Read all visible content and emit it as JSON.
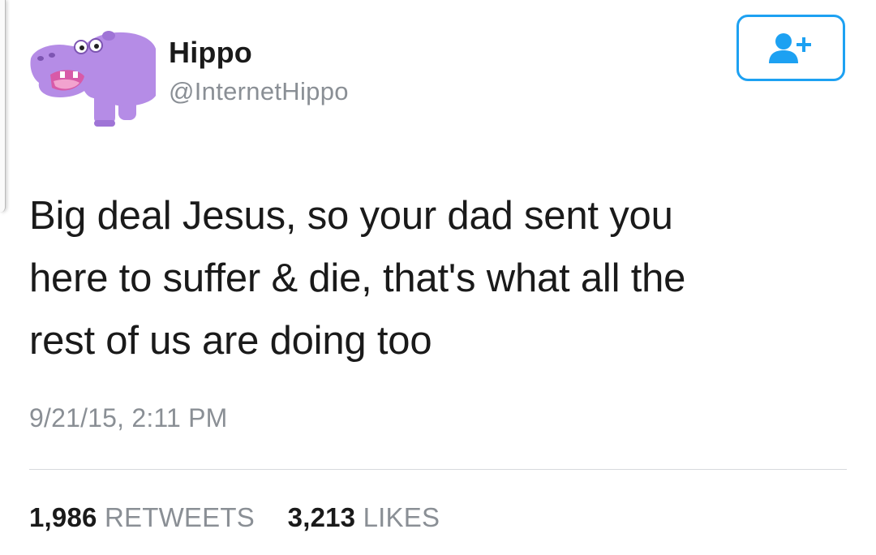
{
  "author": {
    "display_name": "Hippo",
    "handle": "@InternetHippo",
    "avatar_icon": "purple-hippo-avatar",
    "avatar_color": "#b58ce6"
  },
  "follow_button": {
    "icon": "add-user-icon",
    "color": "#1da1f2"
  },
  "tweet": {
    "lines": [
      "Big deal Jesus, so your dad sent you",
      "here to suffer & die, that's what all the",
      "rest of us are doing too"
    ],
    "timestamp": "9/21/15, 2:11 PM"
  },
  "stats": {
    "retweets_count": "1,986",
    "retweets_label": "RETWEETS",
    "likes_count": "3,213",
    "likes_label": "LIKES"
  }
}
